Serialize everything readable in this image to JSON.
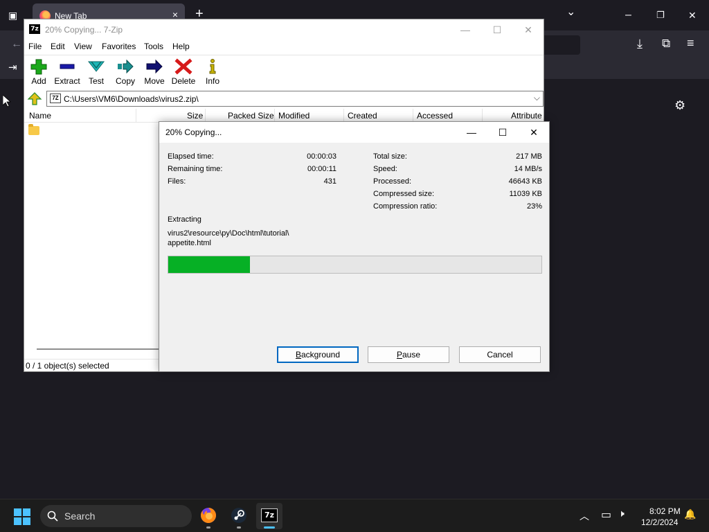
{
  "firefox": {
    "tab_title": "New Tab",
    "tab_close_glyph": "×",
    "new_tab_glyph": "+",
    "tab_list_glyph": "⌄",
    "win_minimize": "–",
    "win_restore": "❐",
    "win_close": "✕",
    "back_glyph": "←",
    "download_glyph": "⤓",
    "extensions_glyph": "⧉",
    "menu_glyph": "≡",
    "settings_glyph": "⚙"
  },
  "zip_window": {
    "title": "20% Copying... 7-Zip",
    "icon_text": "7z",
    "controls": {
      "minimize": "—",
      "maximize": "☐",
      "close": "✕"
    },
    "menu": [
      "File",
      "Edit",
      "View",
      "Favorites",
      "Tools",
      "Help"
    ],
    "toolbar": [
      {
        "label": "Add",
        "icon": "add-icon",
        "color": "#1aa81a"
      },
      {
        "label": "Extract",
        "icon": "extract-icon",
        "color": "#1a1aa8"
      },
      {
        "label": "Test",
        "icon": "test-icon",
        "color": "#1fb7b7"
      },
      {
        "label": "Copy",
        "icon": "copy-icon",
        "color": "#1a8f8f"
      },
      {
        "label": "Move",
        "icon": "move-icon",
        "color": "#101070"
      },
      {
        "label": "Delete",
        "icon": "delete-icon",
        "color": "#d61a1a"
      },
      {
        "label": "Info",
        "icon": "info-icon",
        "color": "#c8b400"
      }
    ],
    "address": "C:\\Users\\VM6\\Downloads\\virus2.zip\\",
    "address_icon_text": "7Z",
    "dropdown_glyph": "⌵",
    "columns": [
      "Name",
      "Size",
      "Packed Size",
      "Modified",
      "Created",
      "Accessed",
      "Attribute"
    ],
    "status": "0 / 1 object(s) selected"
  },
  "copy_dialog": {
    "title": "20% Copying...",
    "controls": {
      "minimize": "—",
      "maximize": "☐",
      "close": "✕"
    },
    "left_stats": [
      {
        "label": "Elapsed time:",
        "value": "00:00:03"
      },
      {
        "label": "Remaining time:",
        "value": "00:00:11"
      },
      {
        "label": "Files:",
        "value": "431"
      }
    ],
    "right_stats": [
      {
        "label": "Total size:",
        "value": "217 MB"
      },
      {
        "label": "Speed:",
        "value": "14 MB/s"
      },
      {
        "label": "Processed:",
        "value": "46643 KB"
      },
      {
        "label": "Compressed size:",
        "value": "11039 KB"
      },
      {
        "label": "Compression ratio:",
        "value": "23%"
      }
    ],
    "operation": "Extracting",
    "path_line1": "virus2\\resource\\py\\Doc\\html\\tutorial\\",
    "path_line2": "appetite.html",
    "progress": 0.218,
    "progress_color": "#06b025",
    "buttons": {
      "background_key": "B",
      "background_rest": "ackground",
      "pause_key": "P",
      "pause_rest": "ause",
      "cancel": "Cancel"
    }
  },
  "taskbar": {
    "search_placeholder": "Search",
    "clock_time": "8:02 PM",
    "clock_date": "12/2/2024",
    "chevron_glyph": "︿",
    "network_glyph": "▭",
    "volume_glyph": "🕨",
    "bell_glyph": "🔔",
    "accent": "#4cc2ff"
  }
}
